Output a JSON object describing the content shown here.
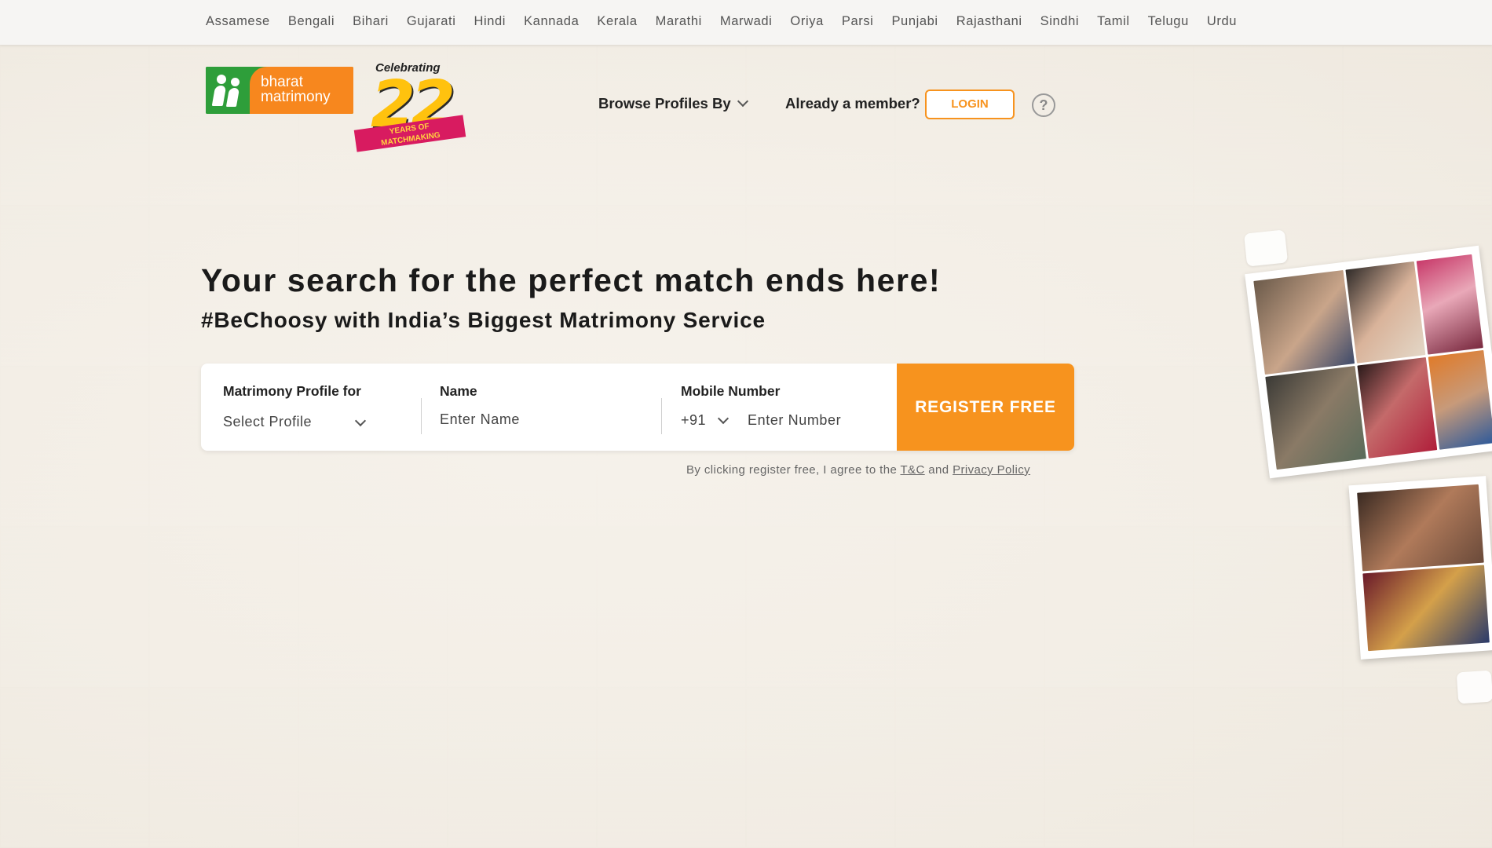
{
  "languages": [
    "Assamese",
    "Bengali",
    "Bihari",
    "Gujarati",
    "Hindi",
    "Kannada",
    "Kerala",
    "Marathi",
    "Marwadi",
    "Oriya",
    "Parsi",
    "Punjabi",
    "Rajasthani",
    "Sindhi",
    "Tamil",
    "Telugu",
    "Urdu"
  ],
  "logo": {
    "line1": "bharat",
    "line2": "matrimony"
  },
  "celebration": {
    "title": "Celebrating",
    "number": "22",
    "ribbon_line1": "YEARS OF",
    "ribbon_line2": "MATCHMAKING"
  },
  "nav": {
    "browse_label": "Browse Profiles By",
    "member_label": "Already a member?",
    "login_label": "LOGIN",
    "help_symbol": "?"
  },
  "hero": {
    "title": "Your search for the perfect match ends here!",
    "subtitle": "#BeChoosy with India’s Biggest Matrimony Service"
  },
  "form": {
    "profile_label": "Matrimony Profile for",
    "profile_value": "Select Profile",
    "name_label": "Name",
    "name_placeholder": "Enter Name",
    "mobile_label": "Mobile Number",
    "country_code": "+91",
    "mobile_placeholder": "Enter Number",
    "register_label": "REGISTER FREE"
  },
  "terms": {
    "text": "By clicking register free, I agree to the",
    "tc_link": "T&C",
    "and": "and",
    "privacy_link": "Privacy Policy"
  },
  "colors": {
    "accent_orange": "#f7931e",
    "logo_green": "#2e9e3a",
    "background": "#f3efe7"
  }
}
